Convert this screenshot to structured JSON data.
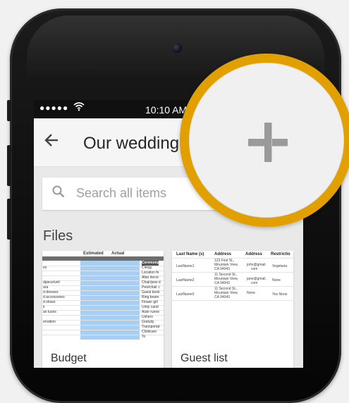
{
  "status": {
    "signal": "●●●●●",
    "time": "10:10 AM"
  },
  "appbar": {
    "title": "Our wedding"
  },
  "search": {
    "placeholder": "Search all items"
  },
  "section": {
    "heading": "Files"
  },
  "files": [
    {
      "title": "Budget",
      "thumb": {
        "headers": [
          "Estimated",
          "Actual"
        ],
        "left_col": [
          "",
          "es",
          "",
          "",
          "dpiece/veil",
          "ara",
          "d dresses",
          "d accessories",
          "d shoes",
          "ir",
          "an tuxes",
          "",
          "ervation"
        ],
        "right_col": [
          "Ceremony",
          "Clergy",
          "Location fe",
          "Altar decor",
          "Chair/pew d",
          "Pew/chair c",
          "Guest book",
          "Ring beare",
          "Flower girl",
          "Unity cand",
          "Aisle runne",
          "Ushers",
          "Gratuity",
          "Transportat",
          "Childcare",
          "To"
        ]
      }
    },
    {
      "title": "Guest list",
      "thumb": {
        "headers": [
          "Last Name (s)",
          "Address",
          "Address",
          "Restrictio"
        ],
        "rows": [
          {
            "name": "LastName1",
            "addr": [
              "123 First St.,",
              "Mountain View,",
              "CA 94043"
            ],
            "email": [
              "john@gmail.",
              "com"
            ],
            "restriction": "Vegetaria"
          },
          {
            "name": "LastName2",
            "addr": [
              "11 Second St.,",
              "Mountain View,",
              "CA 94043"
            ],
            "email": [
              "jane@gmail.",
              "com"
            ],
            "restriction": "None"
          },
          {
            "name": "LastName3",
            "addr": [
              "11 Second St.,",
              "Mountain View,",
              "CA 94043"
            ],
            "email": [
              "None"
            ],
            "restriction": "Yes None"
          }
        ]
      }
    }
  ],
  "fab": {
    "icon": "plus-icon"
  },
  "colors": {
    "ring": "#e2a000",
    "sheet_highlight": "#a8cff2"
  }
}
